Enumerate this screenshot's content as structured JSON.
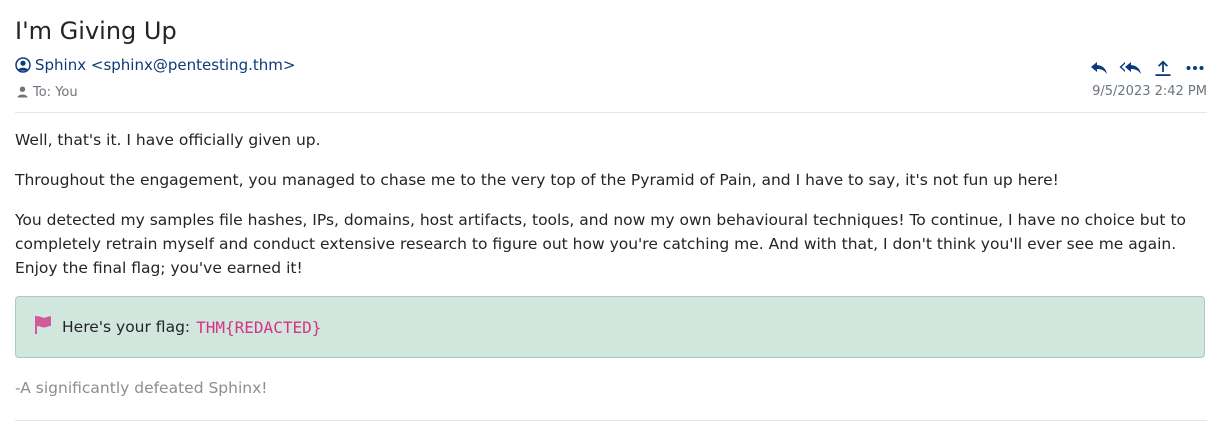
{
  "email": {
    "subject": "I'm Giving Up",
    "sender": "Sphinx <sphinx@pentesting.thm>",
    "recipient": "To: You",
    "date": "9/5/2023 2:42 PM",
    "paragraphs": [
      "Well, that's it. I have officially given up.",
      "Throughout the engagement, you managed to chase me to the very top of the Pyramid of Pain, and I have to say, it's not fun up here!",
      "You detected my samples file hashes, IPs, domains, host artifacts, tools, and now my own behavioural techniques! To continue, I have no choice but to completely retrain myself and conduct extensive research to figure out how you're catching me. And with that, I don't think you'll ever see me again. Enjoy the final flag; you've earned it!"
    ],
    "flag": {
      "label": "Here's your flag:",
      "value": "THM{REDACTED}",
      "icon": "flag-icon"
    },
    "signature": "-A significantly defeated Sphinx!"
  },
  "actions": [
    {
      "name": "reply",
      "icon": "reply-icon"
    },
    {
      "name": "reply-all",
      "icon": "reply-all-icon"
    },
    {
      "name": "forward",
      "icon": "upload-icon"
    },
    {
      "name": "more",
      "icon": "more-icon"
    }
  ],
  "colors": {
    "link": "#0d3b7a",
    "muted": "#6c757d",
    "flag_bg": "#d1e7dd",
    "flag_border": "#a3cfbb",
    "flag_accent": "#d63384"
  }
}
